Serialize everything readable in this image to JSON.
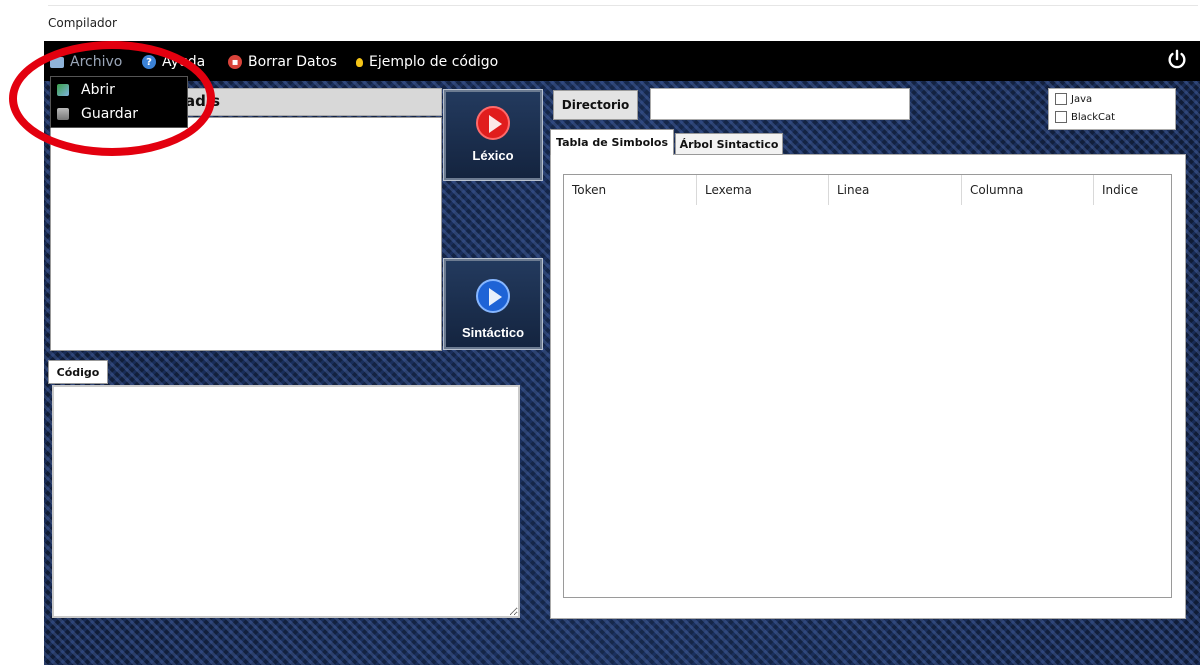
{
  "window": {
    "title": "Compilador"
  },
  "menubar": {
    "items": [
      {
        "label": "Archivo"
      },
      {
        "label": "Ayuda"
      },
      {
        "label": "Borrar Datos"
      },
      {
        "label": "Ejemplo de código"
      }
    ]
  },
  "archivo_menu": {
    "items": [
      {
        "label": "Abrir"
      },
      {
        "label": "Guardar"
      }
    ]
  },
  "left_panel": {
    "header_partial": "ad s"
  },
  "buttons": {
    "lexico": "Léxico",
    "sintactico": "Sintáctico",
    "directorio": "Directorio"
  },
  "directorio": {
    "value": ""
  },
  "languages": [
    {
      "label": "Java",
      "checked": false
    },
    {
      "label": "BlackCat",
      "checked": false
    }
  ],
  "code_tab": {
    "label": "Código"
  },
  "tabs": [
    {
      "label": "Tabla de Simbolos",
      "active": true
    },
    {
      "label": "Árbol Sintactico",
      "active": false
    }
  ],
  "table": {
    "columns": [
      "Token",
      "Lexema",
      "Linea",
      "Columna",
      "Indice"
    ],
    "rows": []
  },
  "colors": {
    "highlight": "#e3000f",
    "lexico_button": "#e11d1d",
    "sintactico_button": "#1e63d6"
  },
  "icons": {
    "archivo": "folder-icon",
    "ayuda": "help-icon",
    "borrar": "trash-icon",
    "ejemplo": "lightbulb-icon",
    "power": "power-icon",
    "abrir": "open-file-icon",
    "guardar": "save-icon"
  }
}
